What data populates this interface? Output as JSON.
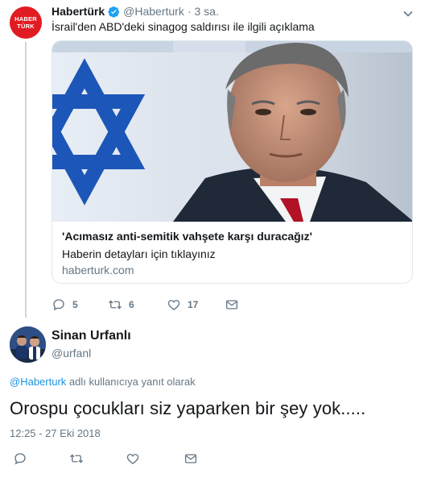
{
  "parent_tweet": {
    "avatar_lines": [
      "HABER",
      "TÜRK"
    ],
    "display_name": "Habertürk",
    "handle": "@Haberturk",
    "separator": "·",
    "time": "3 sa.",
    "text": "İsrail'den ABD'deki sinagog saldırısı ile ilgili açıklama",
    "card": {
      "title": "'Acımasız anti-semitik vahşete karşı duracağız'",
      "description": "Haberin detayları için tıklayınız",
      "domain": "haberturk.com"
    },
    "actions": {
      "reply_count": "5",
      "retweet_count": "6",
      "like_count": "17"
    }
  },
  "reply_tweet": {
    "display_name": "Sinan Urfanlı",
    "handle": "@urfanl",
    "replying_mention": "@Haberturk",
    "replying_suffix": " adlı kullanıcıya yanıt olarak",
    "text": "Orospu çocukları siz yaparken bir şey yok.....",
    "timestamp": "12:25 - 27 Eki 2018"
  },
  "colors": {
    "accent": "#1da1f2",
    "muted": "#657786",
    "brand_red": "#e11b22",
    "border": "#e1e8ed"
  },
  "icons": [
    "verified-badge-icon",
    "chevron-down-icon",
    "reply-icon",
    "retweet-icon",
    "like-icon",
    "direct-message-icon"
  ]
}
